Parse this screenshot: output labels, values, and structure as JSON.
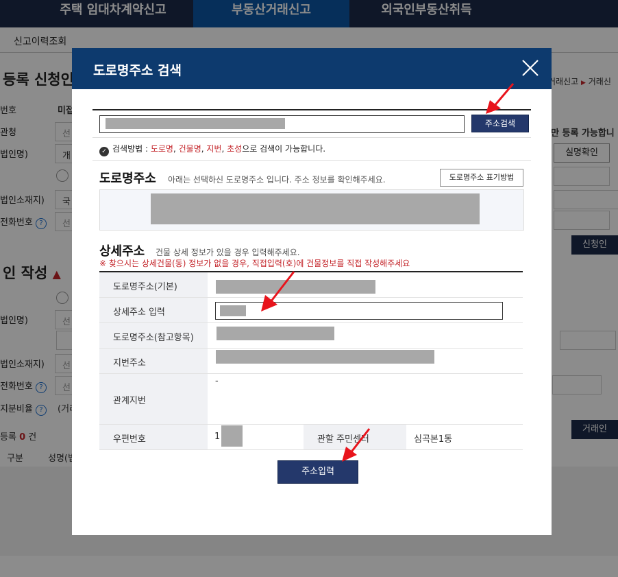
{
  "top_nav": {
    "tabs": [
      {
        "label": "주택 임대차계약신고"
      },
      {
        "label": "부동산거래신고"
      },
      {
        "label": "외국인부동산취득"
      }
    ]
  },
  "sub_nav": {
    "label": "신고이력조회"
  },
  "background": {
    "section1_title": "등록 신청인",
    "section2_title": "인 작성",
    "breadcrumb_a": "거래신고",
    "breadcrumb_b": "거래신",
    "notice_partial": "만 등록 가능합니",
    "labels": [
      "번호",
      "관청",
      "법인명)",
      "법인소재지)",
      "전화번호",
      "법인명)",
      "법인소재지)",
      "전화번호",
      "지분비율"
    ],
    "field_fragments": [
      "미접",
      "선",
      "개",
      "국",
      "선",
      "선",
      "선",
      "선",
      "(거래"
    ],
    "realname_button": "실명확인",
    "applicant_button": "신청인",
    "trade_button": "거래인",
    "register_count_label": "등록",
    "register_count": "0",
    "register_count_unit": "건",
    "col_type": "구분",
    "col_name": "성명(법"
  },
  "modal": {
    "title": "도로명주소 검색",
    "search_button": "주소검색",
    "search_tip_prefix": "검색방법 : ",
    "search_tip_terms": [
      "도로명",
      "건물명",
      "지번",
      "초성"
    ],
    "search_tip_sep": ", ",
    "search_tip_suffix": "으로 검색이 가능합니다.",
    "road_section_title": "도로명주소",
    "road_section_desc": "아래는 선택하신 도로명주소 입니다. 주소 정보를 확인해주세요.",
    "road_format_button": "도로명주소 표기방법",
    "detail_section_title": "상세주소",
    "detail_section_desc": "건물 상세 정보가 있을 경우 입력해주세요.",
    "detail_warning": "※ 찾으시는 상세건물(동) 정보가 없을 경우, 직접입력(호)에 건물정보를 직접 작성해주세요",
    "rows": {
      "road_basic": "도로명주소(기본)",
      "detail_input": "상세주소 입력",
      "road_ref": "도로명주소(참고항목)",
      "jibun": "지번주소",
      "related_jibun": "관계지번",
      "related_jibun_value": "-",
      "postcode": "우편번호",
      "postcode_prefix": "1",
      "center": "관할 주민센터",
      "center_value": "심곡본1동"
    },
    "submit_button": "주소입력"
  },
  "colors": {
    "nav_bg": "#1c2a49",
    "nav_active": "#0b57a4",
    "modal_header": "#0d3a6e",
    "button_navy": "#24386b",
    "warning_red": "#c4252a",
    "arrow_red": "#e8141c"
  }
}
